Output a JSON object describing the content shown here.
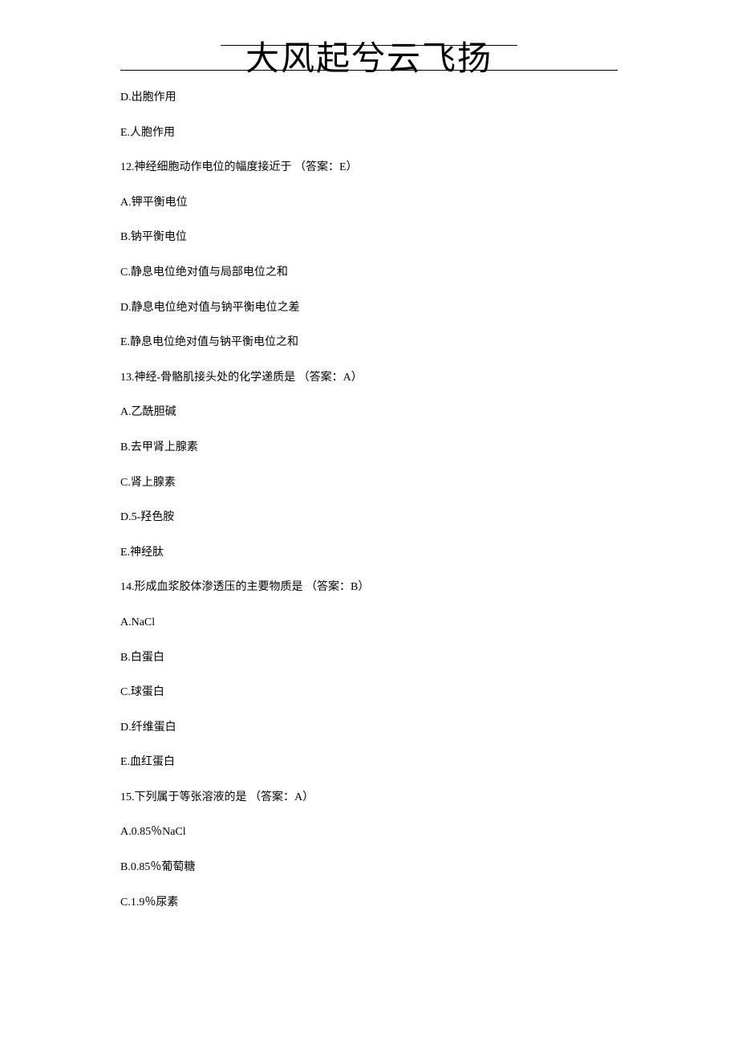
{
  "header": {
    "title": "大风起兮云飞扬"
  },
  "lines": [
    "D.出胞作用",
    "E.人胞作用",
    "12.神经细胞动作电位的幅度接近于 （答案：E）",
    "A.钾平衡电位",
    "B.钠平衡电位",
    "C.静息电位绝对值与局部电位之和",
    "D.静息电位绝对值与钠平衡电位之差",
    "E.静息电位绝对值与钠平衡电位之和",
    "13.神经-骨骼肌接头处的化学递质是 （答案：A）",
    "A.乙酰胆碱",
    "B.去甲肾上腺素",
    "C.肾上腺素",
    "D.5-羟色胺",
    "E.神经肽",
    "14.形成血浆胶体渗透压的主要物质是 （答案：B）",
    "A.NaCl",
    "B.白蛋白",
    "C.球蛋白",
    "D.纤维蛋白",
    "E.血红蛋白",
    "15.下列属于等张溶液的是 （答案：A）",
    "A.0.85％NaCl",
    "B.0.85％葡萄糖",
    "C.1.9％尿素"
  ]
}
